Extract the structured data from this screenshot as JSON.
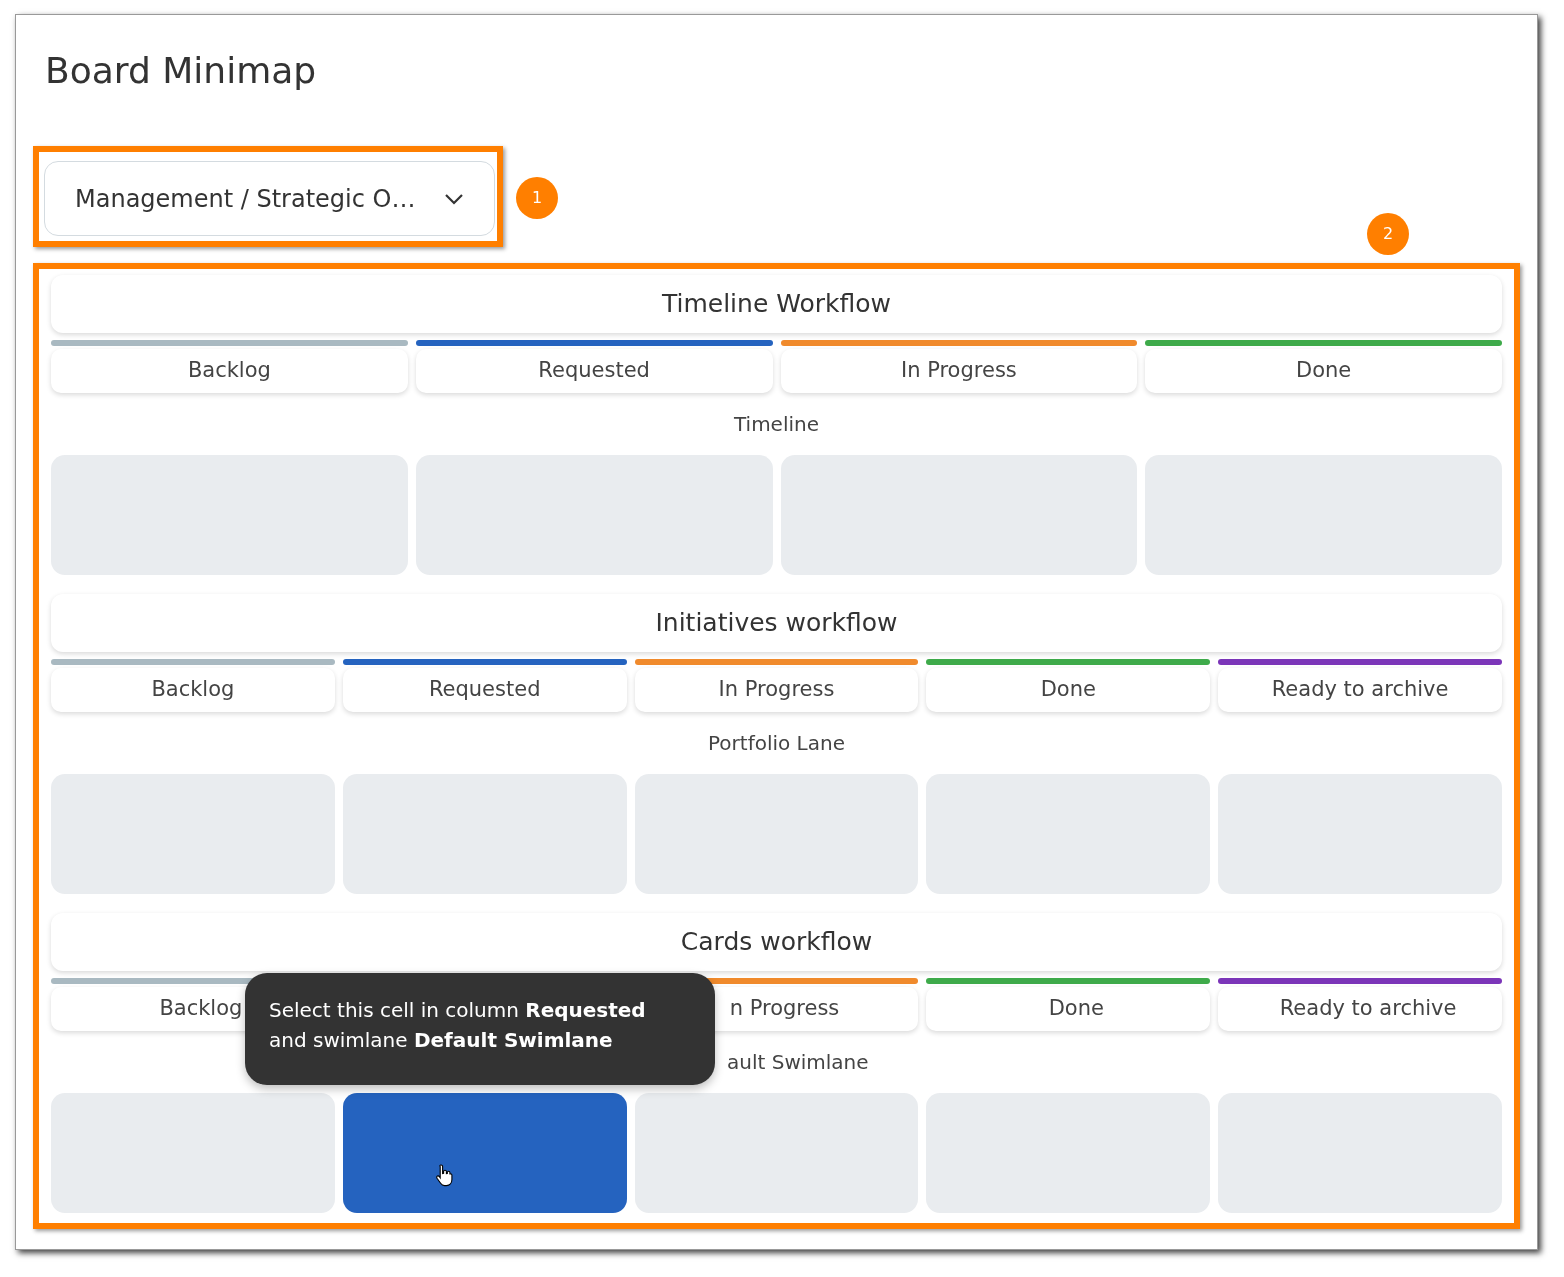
{
  "dialog": {
    "title": "Board Minimap"
  },
  "board_select": {
    "value": "Management / Strategic O…"
  },
  "callouts": [
    "1",
    "2"
  ],
  "workflows": [
    {
      "title": "Timeline Workflow",
      "columns": [
        {
          "label": "Backlog",
          "color": "#a9b9c1"
        },
        {
          "label": "Requested",
          "color": "#2563bf"
        },
        {
          "label": "In Progress",
          "color": "#f08a2c"
        },
        {
          "label": "Done",
          "color": "#3eaa4a"
        }
      ],
      "lanes": [
        {
          "label": "Timeline",
          "cells": [
            {
              "selected": false
            },
            {
              "selected": false
            },
            {
              "selected": false
            },
            {
              "selected": false
            }
          ]
        }
      ]
    },
    {
      "title": "Initiatives workflow",
      "columns": [
        {
          "label": "Backlog",
          "color": "#a9b9c1"
        },
        {
          "label": "Requested",
          "color": "#2563bf"
        },
        {
          "label": "In Progress",
          "color": "#f08a2c"
        },
        {
          "label": "Done",
          "color": "#3eaa4a"
        },
        {
          "label": "Ready to archive",
          "color": "#7b35b8"
        }
      ],
      "lanes": [
        {
          "label": "Portfolio Lane",
          "cells": [
            {
              "selected": false
            },
            {
              "selected": false
            },
            {
              "selected": false
            },
            {
              "selected": false
            },
            {
              "selected": false
            }
          ]
        }
      ]
    },
    {
      "title": "Cards workflow",
      "columns": [
        {
          "label": "Backlog",
          "color": "#a9b9c1"
        },
        {},
        {
          "label": "n Progress",
          "color": "#f08a2c"
        },
        {
          "label": "Done",
          "color": "#3eaa4a"
        },
        {
          "label": "Ready to archive",
          "color": "#7b35b8"
        }
      ],
      "lanes": [
        {
          "label": "ault Swimlane",
          "cells": [
            {
              "selected": false
            },
            {
              "selected": true
            },
            {
              "selected": false
            },
            {
              "selected": false
            },
            {
              "selected": false
            }
          ]
        }
      ],
      "tooltip": "Select this cell in column **Requested**\nand swimlane **Default Swimlane**"
    }
  ]
}
